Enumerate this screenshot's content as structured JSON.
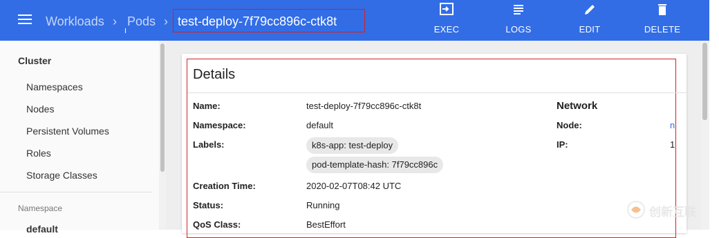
{
  "header": {
    "breadcrumbs": [
      "Workloads",
      "Pods"
    ],
    "current": "test-deploy-7f79cc896c-ctk8t",
    "actions": [
      {
        "icon": "exec-icon",
        "label": "EXEC"
      },
      {
        "icon": "logs-icon",
        "label": "LOGS"
      },
      {
        "icon": "edit-icon",
        "label": "EDIT"
      },
      {
        "icon": "delete-icon",
        "label": "DELETE"
      }
    ],
    "color": "#326de6"
  },
  "sidebar": {
    "section": "Cluster",
    "items": [
      "Namespaces",
      "Nodes",
      "Persistent Volumes",
      "Roles",
      "Storage Classes"
    ],
    "namespace_label": "Namespace",
    "namespace_value": "default"
  },
  "details": {
    "title": "Details",
    "rows": [
      {
        "key": "Name:",
        "value": "test-deploy-7f79cc896c-ctk8t"
      },
      {
        "key": "Namespace:",
        "value": "default"
      },
      {
        "key": "Labels:",
        "chips": [
          "k8s-app: test-deploy",
          "pod-template-hash: 7f79cc896c"
        ]
      },
      {
        "key": "Creation Time:",
        "value": "2020-02-07T08:42 UTC"
      },
      {
        "key": "Status:",
        "value": "Running"
      },
      {
        "key": "QoS Class:",
        "value": "BestEffort"
      }
    ]
  },
  "network": {
    "title": "Network",
    "node_key": "Node:",
    "node_value": "n",
    "ip_key": "IP:",
    "ip_value": "1"
  },
  "watermark": {
    "text": "创新互联"
  }
}
